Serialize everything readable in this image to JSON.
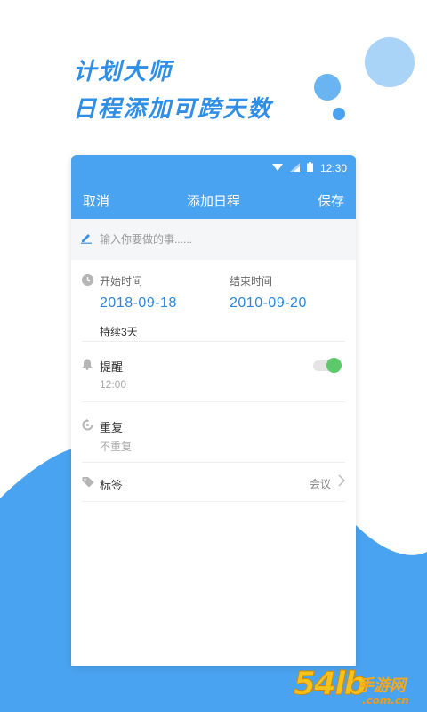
{
  "promo": {
    "line1": "计划大师",
    "line2": "日程添加可跨天数"
  },
  "status_bar": {
    "time": "12:30",
    "icons": [
      "wifi-icon",
      "signal-icon",
      "battery-icon"
    ]
  },
  "app_bar": {
    "cancel_label": "取消",
    "title": "添加日程",
    "save_label": "保存"
  },
  "event_input": {
    "placeholder": "输入你要做的事......",
    "value": ""
  },
  "time": {
    "start_label": "开始时间",
    "start_value": "2018-09-18",
    "end_label": "结束时间",
    "end_value": "2010-09-20",
    "duration": "持续3天"
  },
  "reminder": {
    "label": "提醒",
    "value": "12:00",
    "enabled": true
  },
  "repeat": {
    "label": "重复",
    "value": "不重复"
  },
  "tag": {
    "label": "标签",
    "value": "会议"
  },
  "watermark": {
    "number": "54lb",
    "cn": "手游网",
    "site": ".com.cn"
  },
  "colors": {
    "primary": "#4aa3f0",
    "accent_text": "#2c86dd",
    "toggle_on": "#5cc96a",
    "background_blob": "#4aa3f0"
  }
}
